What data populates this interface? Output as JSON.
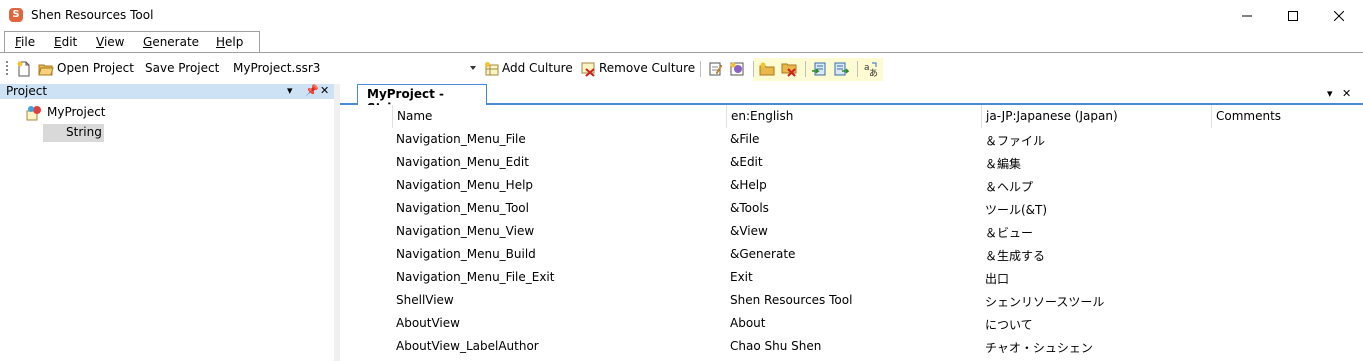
{
  "window": {
    "title": "Shen Resources Tool",
    "app_icon_letter": "S"
  },
  "menu": {
    "file": {
      "u": "F",
      "rest": "ile"
    },
    "edit": {
      "u": "E",
      "rest": "dit"
    },
    "view": {
      "u": "V",
      "rest": "iew"
    },
    "generate": {
      "u": "G",
      "rest": "enerate"
    },
    "help": {
      "u": "H",
      "rest": "elp"
    }
  },
  "toolbar": {
    "open_project": "Open Project",
    "save_project": "Save Project",
    "project_file": "MyProject.ssr3",
    "add_culture": "Add Culture",
    "remove_culture": "Remove Culture"
  },
  "project_panel": {
    "title": "Project",
    "root": "MyProject",
    "child": "String"
  },
  "document": {
    "tab_title": "MyProject - String"
  },
  "grid": {
    "columns": [
      "Name",
      "en:English",
      "ja-JP:Japanese (Japan)",
      "Comments"
    ],
    "rows": [
      [
        "Navigation_Menu_File",
        "&File",
        "＆ファイル",
        ""
      ],
      [
        "Navigation_Menu_Edit",
        "&Edit",
        "＆編集",
        ""
      ],
      [
        "Navigation_Menu_Help",
        "&Help",
        "＆ヘルプ",
        ""
      ],
      [
        "Navigation_Menu_Tool",
        "&Tools",
        "ツール(&T)",
        ""
      ],
      [
        "Navigation_Menu_View",
        "&View",
        "＆ビュー",
        ""
      ],
      [
        "Navigation_Menu_Build",
        "&Generate",
        "＆生成する",
        ""
      ],
      [
        "Navigation_Menu_File_Exit",
        "Exit",
        "出口",
        ""
      ],
      [
        "ShellView",
        "Shen Resources Tool",
        "シェンリソースツール",
        ""
      ],
      [
        "AboutView",
        "About",
        "について",
        ""
      ],
      [
        "AboutView_LabelAuthor",
        "Chao Shu Shen",
        "チャオ・シュシェン",
        ""
      ]
    ]
  },
  "colors": {
    "panel_header": "#cde3f5",
    "tab_accent": "#4a8ad0",
    "selection": "#d9d9d9",
    "toolbar_highlight": "#fdfbd1"
  }
}
